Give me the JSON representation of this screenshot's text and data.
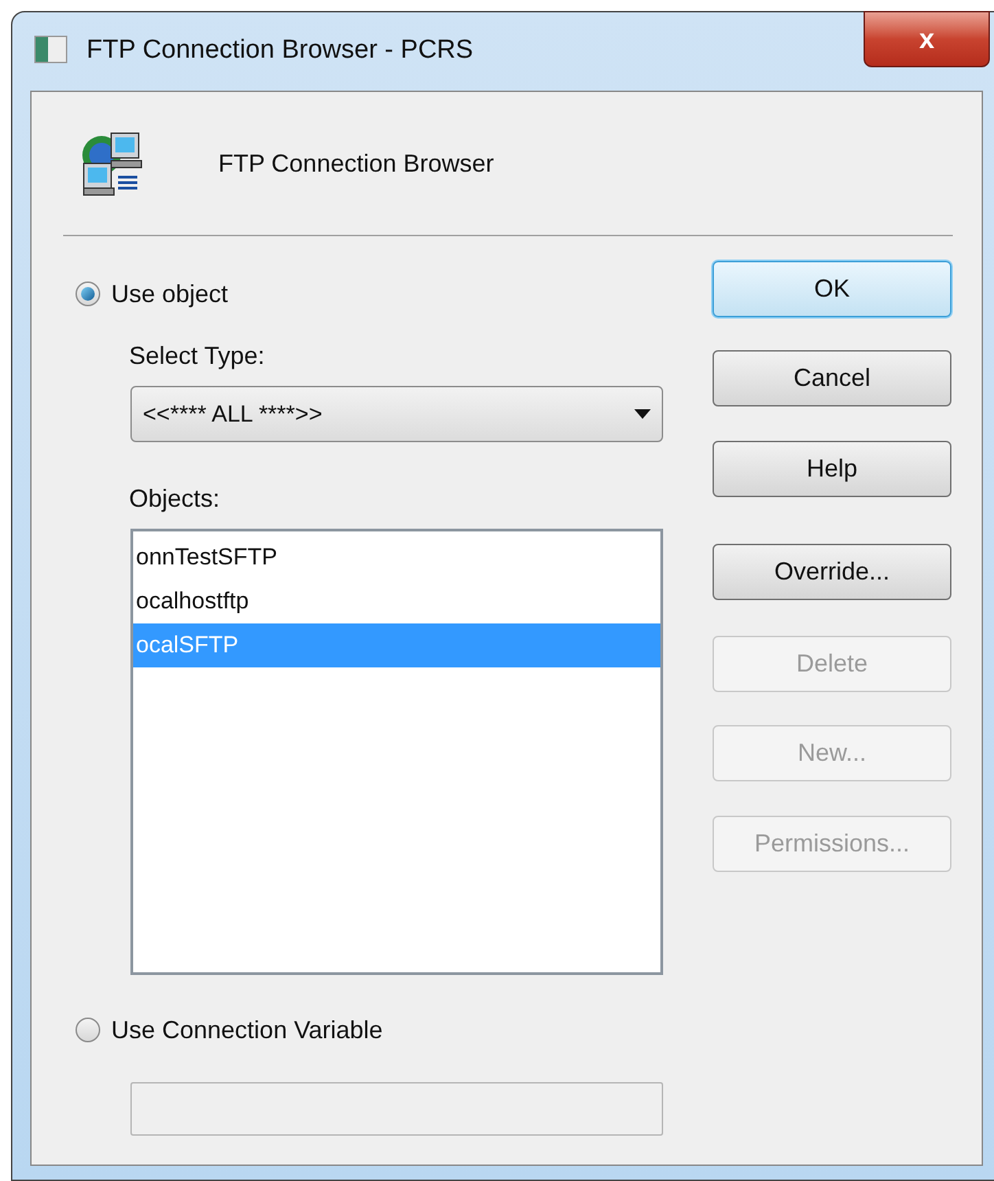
{
  "window": {
    "title": "FTP Connection Browser - PCRS",
    "close": "x"
  },
  "header": {
    "title": "FTP Connection Browser"
  },
  "use_object": {
    "label": "Use object",
    "selected": true
  },
  "select_type": {
    "label": "Select Type:",
    "value": "<<**** ALL ****>>"
  },
  "objects": {
    "label": "Objects:",
    "items": [
      {
        "text": "onnTestSFTP",
        "selected": false
      },
      {
        "text": "ocalhostftp",
        "selected": false
      },
      {
        "text": "ocalSFTP",
        "selected": true
      }
    ]
  },
  "use_variable": {
    "label": "Use Connection Variable",
    "selected": false
  },
  "variable_field": {
    "disabled": true
  },
  "buttons": [
    {
      "label": "OK",
      "disabled": false,
      "default": true
    },
    {
      "label": "Cancel",
      "disabled": false,
      "default": false
    },
    {
      "label": "Help",
      "disabled": false,
      "default": false
    },
    {
      "label": "Override...",
      "disabled": false,
      "default": false
    },
    {
      "label": "Delete",
      "disabled": true,
      "default": false
    },
    {
      "label": "New...",
      "disabled": true,
      "default": false
    },
    {
      "label": "Permissions...",
      "disabled": true,
      "default": false
    }
  ]
}
